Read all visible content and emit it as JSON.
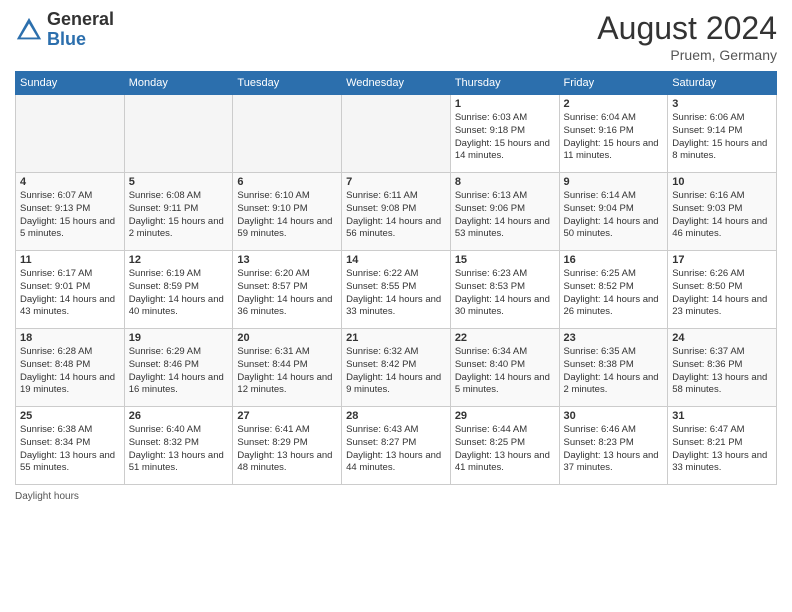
{
  "header": {
    "logo_general": "General",
    "logo_blue": "Blue",
    "month": "August 2024",
    "location": "Pruem, Germany"
  },
  "days_of_week": [
    "Sunday",
    "Monday",
    "Tuesday",
    "Wednesday",
    "Thursday",
    "Friday",
    "Saturday"
  ],
  "footer": {
    "note": "Daylight hours"
  },
  "weeks": [
    [
      {
        "day": "",
        "empty": true
      },
      {
        "day": "",
        "empty": true
      },
      {
        "day": "",
        "empty": true
      },
      {
        "day": "",
        "empty": true
      },
      {
        "day": "1",
        "sunrise": "Sunrise: 6:03 AM",
        "sunset": "Sunset: 9:18 PM",
        "daylight": "Daylight: 15 hours and 14 minutes."
      },
      {
        "day": "2",
        "sunrise": "Sunrise: 6:04 AM",
        "sunset": "Sunset: 9:16 PM",
        "daylight": "Daylight: 15 hours and 11 minutes."
      },
      {
        "day": "3",
        "sunrise": "Sunrise: 6:06 AM",
        "sunset": "Sunset: 9:14 PM",
        "daylight": "Daylight: 15 hours and 8 minutes."
      }
    ],
    [
      {
        "day": "4",
        "sunrise": "Sunrise: 6:07 AM",
        "sunset": "Sunset: 9:13 PM",
        "daylight": "Daylight: 15 hours and 5 minutes."
      },
      {
        "day": "5",
        "sunrise": "Sunrise: 6:08 AM",
        "sunset": "Sunset: 9:11 PM",
        "daylight": "Daylight: 15 hours and 2 minutes."
      },
      {
        "day": "6",
        "sunrise": "Sunrise: 6:10 AM",
        "sunset": "Sunset: 9:10 PM",
        "daylight": "Daylight: 14 hours and 59 minutes."
      },
      {
        "day": "7",
        "sunrise": "Sunrise: 6:11 AM",
        "sunset": "Sunset: 9:08 PM",
        "daylight": "Daylight: 14 hours and 56 minutes."
      },
      {
        "day": "8",
        "sunrise": "Sunrise: 6:13 AM",
        "sunset": "Sunset: 9:06 PM",
        "daylight": "Daylight: 14 hours and 53 minutes."
      },
      {
        "day": "9",
        "sunrise": "Sunrise: 6:14 AM",
        "sunset": "Sunset: 9:04 PM",
        "daylight": "Daylight: 14 hours and 50 minutes."
      },
      {
        "day": "10",
        "sunrise": "Sunrise: 6:16 AM",
        "sunset": "Sunset: 9:03 PM",
        "daylight": "Daylight: 14 hours and 46 minutes."
      }
    ],
    [
      {
        "day": "11",
        "sunrise": "Sunrise: 6:17 AM",
        "sunset": "Sunset: 9:01 PM",
        "daylight": "Daylight: 14 hours and 43 minutes."
      },
      {
        "day": "12",
        "sunrise": "Sunrise: 6:19 AM",
        "sunset": "Sunset: 8:59 PM",
        "daylight": "Daylight: 14 hours and 40 minutes."
      },
      {
        "day": "13",
        "sunrise": "Sunrise: 6:20 AM",
        "sunset": "Sunset: 8:57 PM",
        "daylight": "Daylight: 14 hours and 36 minutes."
      },
      {
        "day": "14",
        "sunrise": "Sunrise: 6:22 AM",
        "sunset": "Sunset: 8:55 PM",
        "daylight": "Daylight: 14 hours and 33 minutes."
      },
      {
        "day": "15",
        "sunrise": "Sunrise: 6:23 AM",
        "sunset": "Sunset: 8:53 PM",
        "daylight": "Daylight: 14 hours and 30 minutes."
      },
      {
        "day": "16",
        "sunrise": "Sunrise: 6:25 AM",
        "sunset": "Sunset: 8:52 PM",
        "daylight": "Daylight: 14 hours and 26 minutes."
      },
      {
        "day": "17",
        "sunrise": "Sunrise: 6:26 AM",
        "sunset": "Sunset: 8:50 PM",
        "daylight": "Daylight: 14 hours and 23 minutes."
      }
    ],
    [
      {
        "day": "18",
        "sunrise": "Sunrise: 6:28 AM",
        "sunset": "Sunset: 8:48 PM",
        "daylight": "Daylight: 14 hours and 19 minutes."
      },
      {
        "day": "19",
        "sunrise": "Sunrise: 6:29 AM",
        "sunset": "Sunset: 8:46 PM",
        "daylight": "Daylight: 14 hours and 16 minutes."
      },
      {
        "day": "20",
        "sunrise": "Sunrise: 6:31 AM",
        "sunset": "Sunset: 8:44 PM",
        "daylight": "Daylight: 14 hours and 12 minutes."
      },
      {
        "day": "21",
        "sunrise": "Sunrise: 6:32 AM",
        "sunset": "Sunset: 8:42 PM",
        "daylight": "Daylight: 14 hours and 9 minutes."
      },
      {
        "day": "22",
        "sunrise": "Sunrise: 6:34 AM",
        "sunset": "Sunset: 8:40 PM",
        "daylight": "Daylight: 14 hours and 5 minutes."
      },
      {
        "day": "23",
        "sunrise": "Sunrise: 6:35 AM",
        "sunset": "Sunset: 8:38 PM",
        "daylight": "Daylight: 14 hours and 2 minutes."
      },
      {
        "day": "24",
        "sunrise": "Sunrise: 6:37 AM",
        "sunset": "Sunset: 8:36 PM",
        "daylight": "Daylight: 13 hours and 58 minutes."
      }
    ],
    [
      {
        "day": "25",
        "sunrise": "Sunrise: 6:38 AM",
        "sunset": "Sunset: 8:34 PM",
        "daylight": "Daylight: 13 hours and 55 minutes."
      },
      {
        "day": "26",
        "sunrise": "Sunrise: 6:40 AM",
        "sunset": "Sunset: 8:32 PM",
        "daylight": "Daylight: 13 hours and 51 minutes."
      },
      {
        "day": "27",
        "sunrise": "Sunrise: 6:41 AM",
        "sunset": "Sunset: 8:29 PM",
        "daylight": "Daylight: 13 hours and 48 minutes."
      },
      {
        "day": "28",
        "sunrise": "Sunrise: 6:43 AM",
        "sunset": "Sunset: 8:27 PM",
        "daylight": "Daylight: 13 hours and 44 minutes."
      },
      {
        "day": "29",
        "sunrise": "Sunrise: 6:44 AM",
        "sunset": "Sunset: 8:25 PM",
        "daylight": "Daylight: 13 hours and 41 minutes."
      },
      {
        "day": "30",
        "sunrise": "Sunrise: 6:46 AM",
        "sunset": "Sunset: 8:23 PM",
        "daylight": "Daylight: 13 hours and 37 minutes."
      },
      {
        "day": "31",
        "sunrise": "Sunrise: 6:47 AM",
        "sunset": "Sunset: 8:21 PM",
        "daylight": "Daylight: 13 hours and 33 minutes."
      }
    ]
  ]
}
